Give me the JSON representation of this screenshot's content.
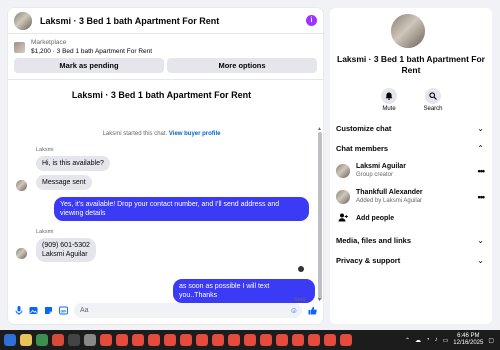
{
  "header": {
    "title": "Laksmi · 3 Bed 1 bath Apartment For Rent",
    "info_icon": "info-icon",
    "accent": "#a033ff"
  },
  "listing": {
    "source": "Marketplace",
    "price_title": "$1,200 · 3 Bed 1 bath Apartment For Rent"
  },
  "buttons": {
    "mark_pending": "Mark as pending",
    "more_options": "More options"
  },
  "conversation": {
    "title": "Laksmi · 3 Bed 1 bath Apartment For Rent",
    "started_text": "Laksmi started this chat.",
    "view_profile": "View buyer profile",
    "messages": [
      {
        "sender": "Laksmi",
        "text": "Hi, is this available?"
      },
      {
        "text": "Message sent"
      },
      {
        "text": "Yes, it's available! Drop your contact number, and I'll send address and viewing details"
      },
      {
        "sender": "Laksmi",
        "line1": "(909) 601-5302",
        "line2": "Laksmi Aguilar"
      },
      {
        "text": "as soon as possible I will text you..Thanks"
      }
    ],
    "sent_status": "Sent",
    "out_color": "#3b3bf5"
  },
  "composer": {
    "placeholder": "Aa"
  },
  "sidebar": {
    "name_line1": "Laksmi · 3 Bed 1 bath Apartment For",
    "name_line2": "Rent",
    "actions": {
      "mute": "Mute",
      "search": "Search"
    },
    "customize_chat": "Customize chat",
    "chat_members": "Chat members",
    "members": [
      {
        "name": "Laksmi Aguilar",
        "role": "Group creator"
      },
      {
        "name": "Thankfull Alexander",
        "role": "Added by Laksmi Aguilar"
      }
    ],
    "add_people": "Add people",
    "media_files_links": "Media, files and links",
    "privacy_support": "Privacy & support"
  },
  "taskbar": {
    "time": "6:46 PM",
    "date": "12/16/2025"
  }
}
